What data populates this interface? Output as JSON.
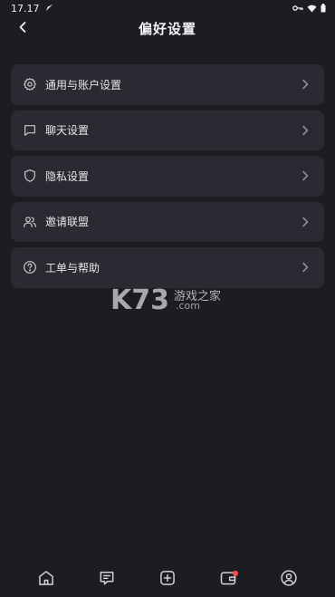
{
  "status_bar": {
    "time": "17.17",
    "icons": [
      "location-arrow-icon",
      "key-icon",
      "wifi-icon",
      "battery-icon"
    ]
  },
  "header": {
    "title": "偏好设置",
    "back_icon": "chevron-left-icon"
  },
  "settings": {
    "items": [
      {
        "label": "通用与账户设置",
        "icon": "gear-icon"
      },
      {
        "label": "聊天设置",
        "icon": "chat-bubble-icon"
      },
      {
        "label": "隐私设置",
        "icon": "shield-icon"
      },
      {
        "label": "邀请联盟",
        "icon": "users-icon"
      },
      {
        "label": "工单与帮助",
        "icon": "help-circle-icon"
      }
    ]
  },
  "watermark": {
    "brand": "K73",
    "text": "游戏之家",
    "domain": ".com"
  },
  "bottom_nav": {
    "items": [
      "home-icon",
      "message-icon",
      "add-icon",
      "wallet-icon",
      "profile-icon"
    ],
    "badge_color": "#ff4d4f"
  },
  "colors": {
    "background": "#1c1d23",
    "card": "#2a2b32",
    "text": "#e6e6ea",
    "icon": "#c9cad0"
  }
}
